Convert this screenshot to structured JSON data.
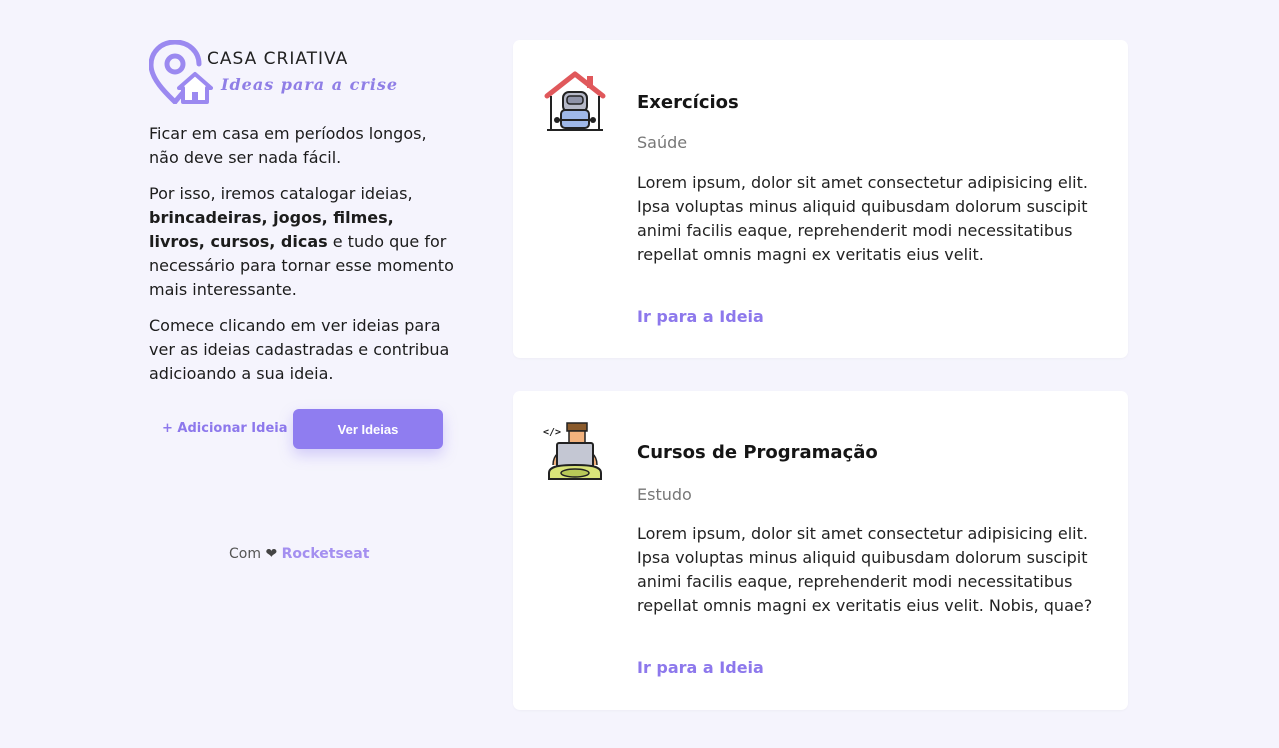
{
  "brand": {
    "name": "CASA CRIATIVA",
    "tagline": "Ideas para a crise",
    "accent": "#8f7df0"
  },
  "intro": {
    "p1": "Ficar em casa em períodos longos, não deve ser nada fácil.",
    "p2_prefix": "Por isso, iremos catalogar ideias, ",
    "p2_bold": "brincadeiras, jogos, filmes, livros, cursos, dicas",
    "p2_suffix": " e tudo que for necessário para tornar esse momento mais interessante.",
    "p3": "Comece clicando em ver ideias para ver as ideias cadastradas e contribua adicioando a sua ideia."
  },
  "actions": {
    "add_label": "+ Adicionar Ideia",
    "view_label": "Ver Ideias"
  },
  "footer": {
    "prefix": "Com",
    "heart": "❤",
    "link": "Rocketseat"
  },
  "ideas": [
    {
      "icon": "home-workout-icon",
      "title": "Exercícios",
      "category": "Saúde",
      "description": "Lorem ipsum, dolor sit amet consectetur adipisicing elit. Ipsa voluptas minus aliquid quibusdam dolorum suscipit animi facilis eaque, reprehenderit modi necessitatibus repellat omnis magni ex veritatis eius velit.",
      "link_label": "Ir para a Ideia"
    },
    {
      "icon": "programmer-icon",
      "title": "Cursos de Programação",
      "category": "Estudo",
      "description": "Lorem ipsum, dolor sit amet consectetur adipisicing elit. Ipsa voluptas minus aliquid quibusdam dolorum suscipit animi facilis eaque, reprehenderit modi necessitatibus repellat omnis magni ex veritatis eius velit. Nobis, quae?",
      "link_label": "Ir para a Ideia"
    }
  ]
}
